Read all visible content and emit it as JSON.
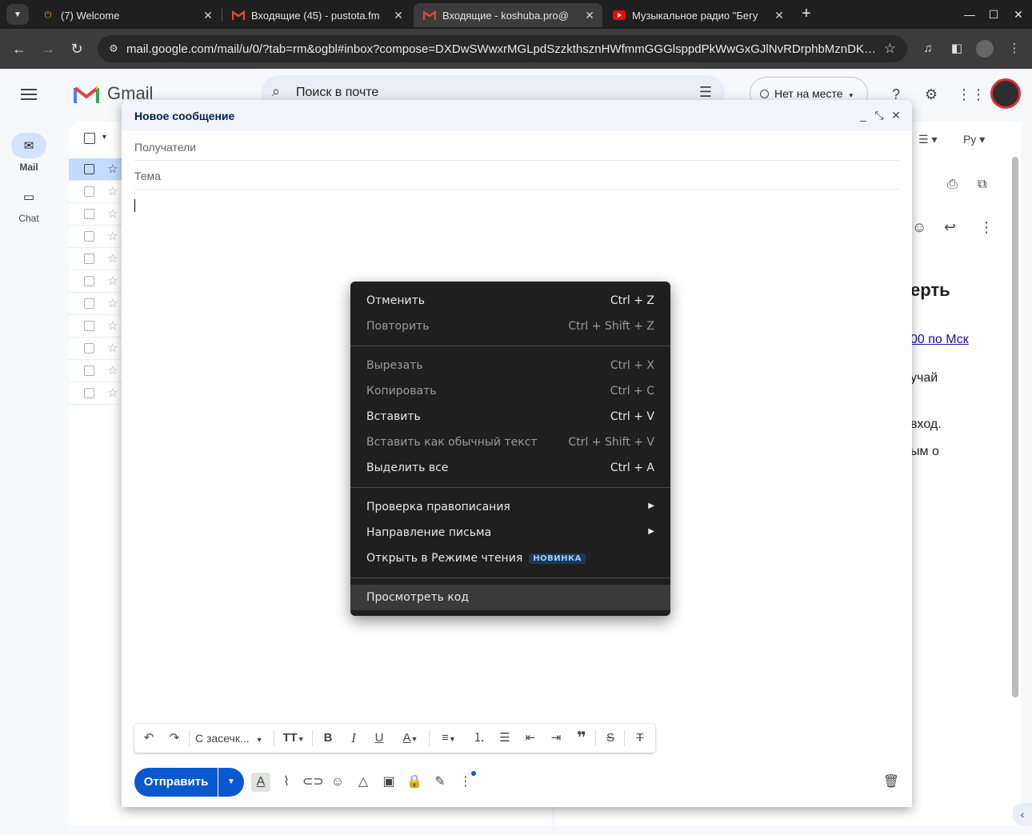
{
  "browser": {
    "tabs": [
      {
        "title": "(7) Welcome",
        "icon": "power-icon"
      },
      {
        "title": "Входящие (45) - pustota.fm",
        "icon": "gmail-icon"
      },
      {
        "title": "Входящие - koshuba.pro@",
        "icon": "gmail-icon",
        "active": true
      },
      {
        "title": "Музыкальное радио \"Бегу",
        "icon": "youtube-icon"
      }
    ],
    "url": "mail.google.com/mail/u/0/?tab=rm&ogbl#inbox?compose=DXDwSWwxrMGLpdSzzkthsznHWfmmGGGlsppdPkWwGxGJlNvRDrphbMznDKslg..."
  },
  "gmail": {
    "logo_text": "Gmail",
    "search_placeholder": "Поиск в почте",
    "status": "Нет на месте",
    "rail": {
      "mail": "Mail",
      "chat": "Chat"
    },
    "input_lang": "Ру",
    "reader_fragments": {
      "heading": "ерть",
      "link": "00 по Мск",
      "line1": "учай",
      "line2": "вход.",
      "line3": "ым о"
    }
  },
  "compose": {
    "title": "Новое сообщение",
    "recipients_placeholder": "Получатели",
    "subject_placeholder": "Тема",
    "font_name": "С засечк...",
    "send_label": "Отправить"
  },
  "context_menu": {
    "undo": {
      "label": "Отменить",
      "shortcut": "Ctrl + Z"
    },
    "redo": {
      "label": "Повторить",
      "shortcut": "Ctrl + Shift + Z"
    },
    "cut": {
      "label": "Вырезать",
      "shortcut": "Ctrl + X"
    },
    "copy": {
      "label": "Копировать",
      "shortcut": "Ctrl + C"
    },
    "paste": {
      "label": "Вставить",
      "shortcut": "Ctrl + V"
    },
    "paste_plain": {
      "label": "Вставить как обычный текст",
      "shortcut": "Ctrl + Shift + V"
    },
    "select_all": {
      "label": "Выделить все",
      "shortcut": "Ctrl + A"
    },
    "spellcheck": {
      "label": "Проверка правописания"
    },
    "direction": {
      "label": "Направление письма"
    },
    "reading_mode": {
      "label": "Открыть в Режиме чтения",
      "badge": "НОВИНКА"
    },
    "inspect": {
      "label": "Просмотреть код"
    }
  }
}
